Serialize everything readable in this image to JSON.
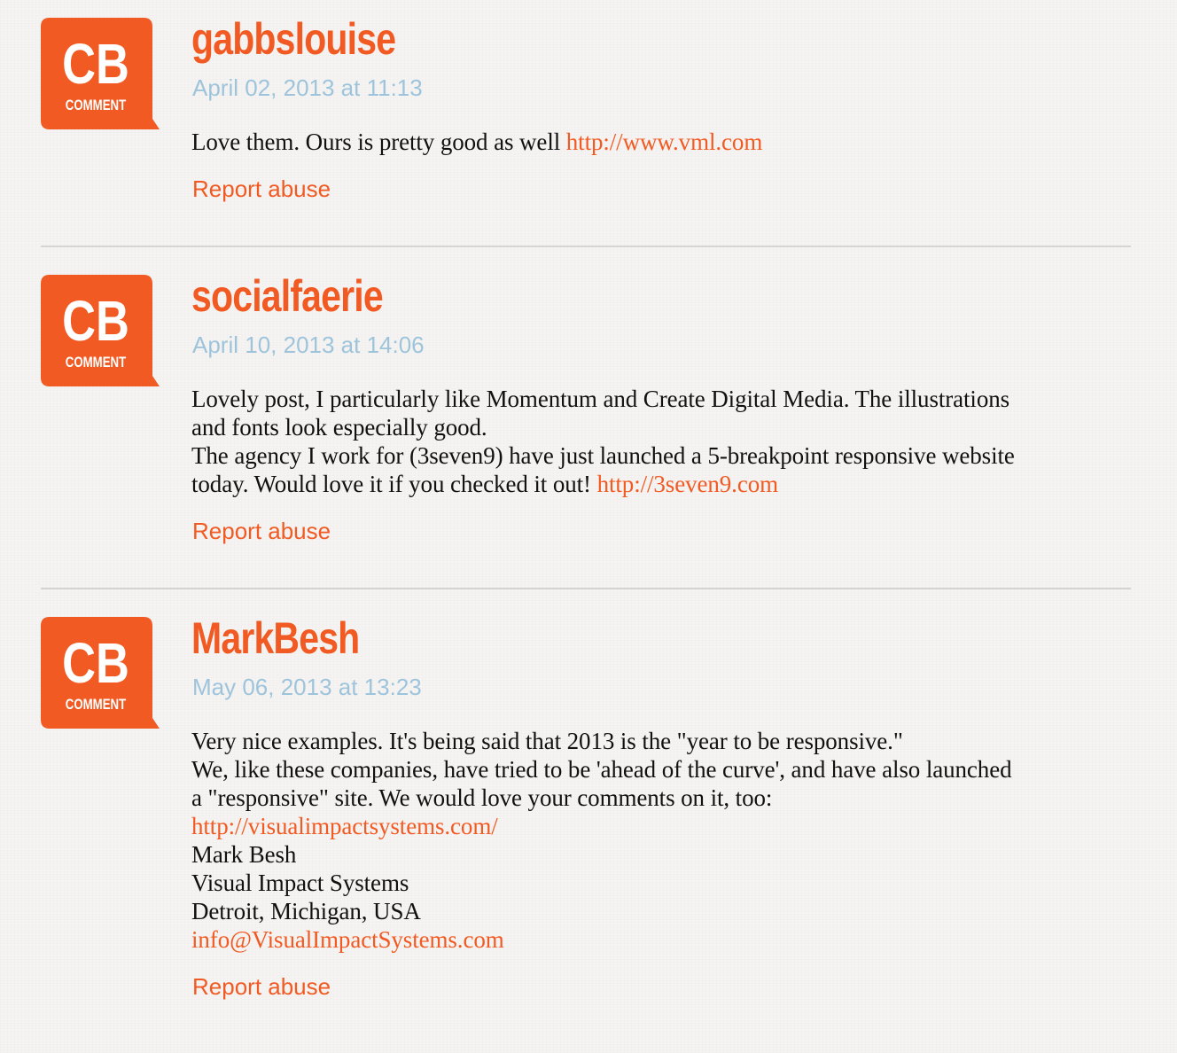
{
  "avatar": {
    "icon": "cb-comment-icon",
    "big_text": "CB",
    "small_text": "COMMENT",
    "color": "#f15a22"
  },
  "comments": [
    {
      "author": "gabbslouise",
      "date": "April 02, 2013 at 11:13",
      "body": {
        "text_1": "Love them. Ours is pretty good as well ",
        "link_1": "http://www.vml.com"
      },
      "report_label": "Report abuse"
    },
    {
      "author": "socialfaerie",
      "date": "April 10, 2013 at 14:06",
      "body": {
        "line_1": "Lovely post, I particularly like Momentum and Create Digital Media. The illustrations",
        "line_2": "and fonts look especially good.",
        "line_3": "The agency I work for (3seven9) have just launched a 5-breakpoint responsive website",
        "line_4_text": "today. Would love it if you checked it out! ",
        "link_1": "http://3seven9.com"
      },
      "report_label": "Report abuse"
    },
    {
      "author": "MarkBesh",
      "date": "May 06, 2013 at 13:23",
      "body": {
        "line_1": "Very nice examples. It's being said that 2013 is the \"year to be responsive.\"",
        "line_2": "We, like these companies, have tried to be 'ahead of the curve', and have also launched",
        "line_3": "a \"responsive\" site. We would love your comments on it, too:",
        "link_1": "http://visualimpactsystems.com/",
        "line_5": "Mark Besh",
        "line_6": "Visual Impact Systems",
        "line_7": "Detroit, Michigan, USA",
        "email": "info@VisualImpactSystems.com"
      },
      "report_label": "Report abuse"
    }
  ],
  "colors": {
    "accent": "#f15a22",
    "date": "#9ec4dc",
    "text": "#111111",
    "divider": "#d4d4d4",
    "background": "#f5f4f2"
  }
}
